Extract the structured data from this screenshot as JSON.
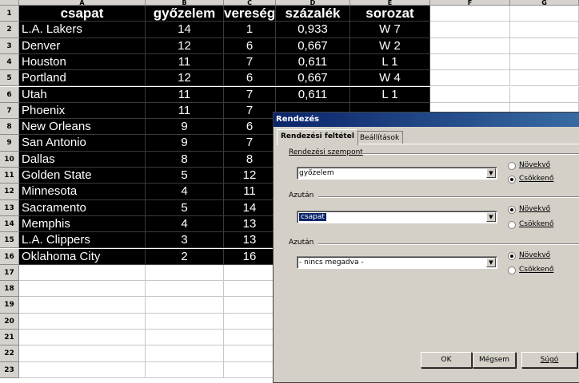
{
  "columns": [
    "A",
    "B",
    "C",
    "D",
    "E",
    "F",
    "G"
  ],
  "row_numbers": [
    "1",
    "2",
    "3",
    "4",
    "5",
    "6",
    "7",
    "8",
    "9",
    "10",
    "11",
    "12",
    "13",
    "14",
    "15",
    "16",
    "17",
    "18",
    "19",
    "20",
    "21",
    "22",
    "23"
  ],
  "header": [
    "csapat",
    "győzelem",
    "vereség",
    "százalék",
    "sorozat"
  ],
  "rows": [
    [
      "L.A. Lakers",
      "14",
      "1",
      "0,933",
      "W 7"
    ],
    [
      "Denver",
      "12",
      "6",
      "0,667",
      "W 2"
    ],
    [
      "Houston",
      "11",
      "7",
      "0,611",
      "L 1"
    ],
    [
      "Portland",
      "12",
      "6",
      "0,667",
      "W 4"
    ],
    [
      "Utah",
      "11",
      "7",
      "0,611",
      "L 1"
    ],
    [
      "Phoenix",
      "11",
      "7",
      "",
      ""
    ],
    [
      "New Orleans",
      "9",
      "6",
      "",
      ""
    ],
    [
      "San Antonio",
      "9",
      "7",
      "",
      ""
    ],
    [
      "Dallas",
      "8",
      "8",
      "",
      ""
    ],
    [
      "Golden State",
      "5",
      "12",
      "",
      ""
    ],
    [
      "Minnesota",
      "4",
      "11",
      "",
      ""
    ],
    [
      "Sacramento",
      "5",
      "14",
      "",
      ""
    ],
    [
      "Memphis",
      "4",
      "13",
      "",
      ""
    ],
    [
      "L.A. Clippers",
      "3",
      "13",
      "",
      ""
    ],
    [
      "Oklahoma City",
      "2",
      "16",
      "",
      ""
    ]
  ],
  "dialog": {
    "title": "Rendezés",
    "tabs": [
      "Rendezési feltétel",
      "Beállítások"
    ],
    "group1": {
      "label": "Rendezési szempont",
      "value": "győzelem",
      "asc": "Növekvő",
      "desc": "Csökkenő",
      "selected": "desc"
    },
    "group2": {
      "label": "Azután",
      "value": "csapat",
      "asc": "Növekvő",
      "desc": "Csökkenő",
      "selected": "asc"
    },
    "group3": {
      "label": "Azután",
      "value": "- nincs megadva -",
      "asc": "Növekvő",
      "desc": "Csökkenő",
      "selected": "asc"
    },
    "buttons": {
      "ok": "OK",
      "cancel": "Mégsem",
      "help": "Súgó"
    }
  }
}
